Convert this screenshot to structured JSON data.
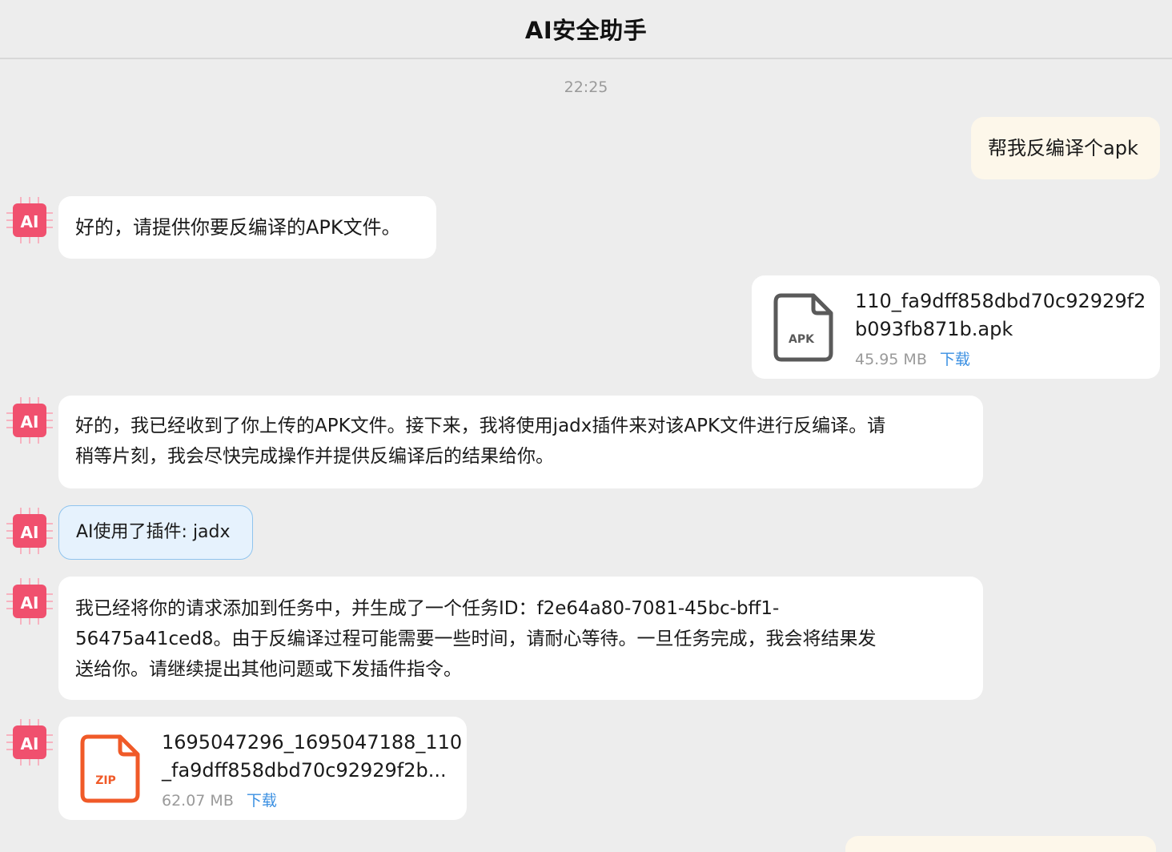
{
  "header": {
    "title": "AI安全助手"
  },
  "timestamp": "22:25",
  "avatar": {
    "label": "AI"
  },
  "messages": {
    "user_1": "帮我反编译个apk",
    "ai_1": "好的，请提供你要反编译的APK文件。",
    "user_file": {
      "icon_label": "APK",
      "name_line1": "110_fa9dff858dbd70c92929f2",
      "name_line2": "b093fb871b.apk",
      "size": "45.95 MB",
      "download": "下载"
    },
    "ai_2_line1": "好的，我已经收到了你上传的APK文件。接下来，我将使用jadx插件来对该APK文件进行反编译。请",
    "ai_2_line2": "稍等片刻，我会尽快完成操作并提供反编译后的结果给你。",
    "plugin_notice": "AI使用了插件: jadx",
    "ai_3_line1": "我已经将你的请求添加到任务中，并生成了一个任务ID：f2e64a80-7081-45bc-bff1-",
    "ai_3_line2": "56475a41ced8。由于反编译过程可能需要一些时间，请耐心等待。一旦任务完成，我会将结果发",
    "ai_3_line3": "送给你。请继续提出其他问题或下发插件指令。",
    "ai_file": {
      "icon_label": "ZIP",
      "name_line1": "1695047296_1695047188_110",
      "name_line2": "_fa9dff858dbd70c92929f2b...",
      "size": "62.07 MB",
      "download": "下载"
    }
  },
  "colors": {
    "background": "#ededed",
    "user_bubble": "#fdf7ea",
    "ai_bubble": "#ffffff",
    "plugin_bubble": "#e6f2fd",
    "link": "#3a8fe2",
    "avatar_accent": "#f0506e",
    "zip_icon": "#f05a28",
    "apk_icon": "#5a5a5a"
  },
  "icons": [
    "ai-chip-avatar-icon",
    "apk-file-icon",
    "zip-file-icon"
  ]
}
